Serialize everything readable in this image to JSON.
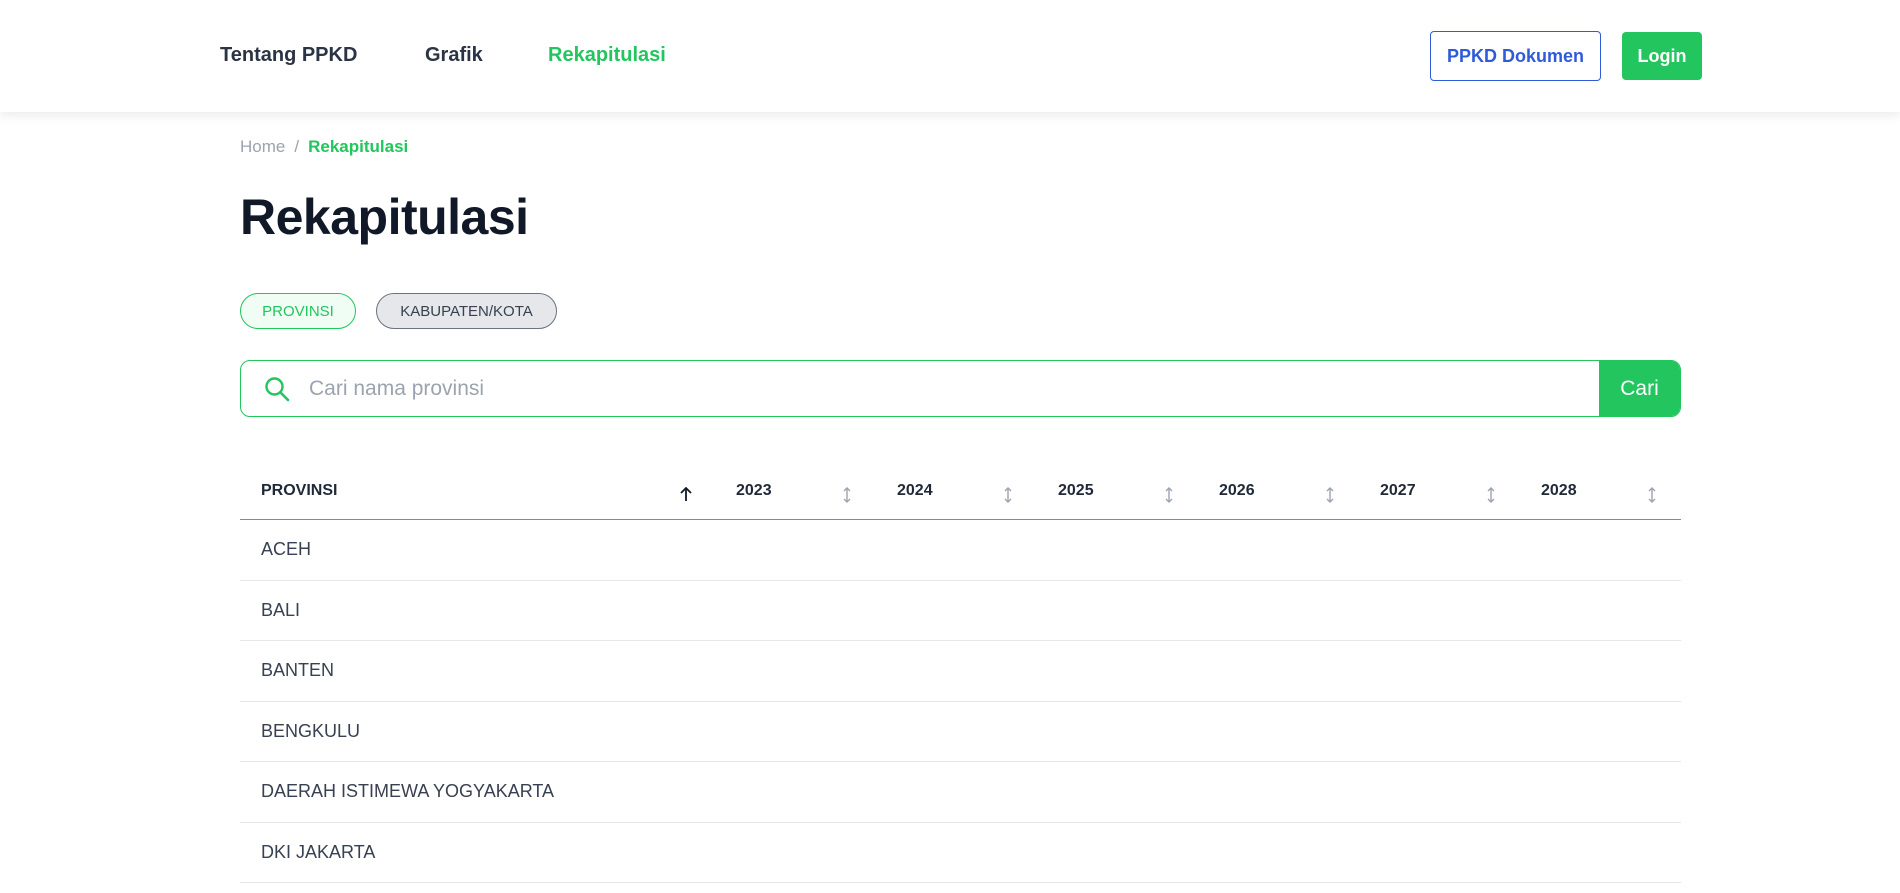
{
  "nav": {
    "links": [
      "Tentang PPKD",
      "Grafik",
      "Rekapitulasi"
    ],
    "active": "Rekapitulasi",
    "doc_button": "PPKD Dokumen",
    "login_button": "Login"
  },
  "breadcrumb": {
    "home": "Home",
    "separator": "/",
    "current": "Rekapitulasi"
  },
  "page": {
    "title": "Rekapitulasi"
  },
  "toggle": {
    "provinsi": "PROVINSI",
    "kabupaten": "KABUPATEN/KOTA",
    "selected": "PROVINSI"
  },
  "search": {
    "placeholder": "Cari nama provinsi",
    "value": "",
    "button": "Cari"
  },
  "table": {
    "columns": [
      "PROVINSI",
      "2023",
      "2024",
      "2025",
      "2026",
      "2027",
      "2028"
    ],
    "sort_column": "PROVINSI",
    "sort_direction": "ascending",
    "rows": [
      "ACEH",
      "BALI",
      "BANTEN",
      "BENGKULU",
      "DAERAH ISTIMEWA YOGYAKARTA",
      "DKI JAKARTA"
    ]
  },
  "colors": {
    "accent": "#22c55e",
    "link_blue": "#2f5bd8",
    "heading": "#111827",
    "muted": "#9ca3af"
  }
}
